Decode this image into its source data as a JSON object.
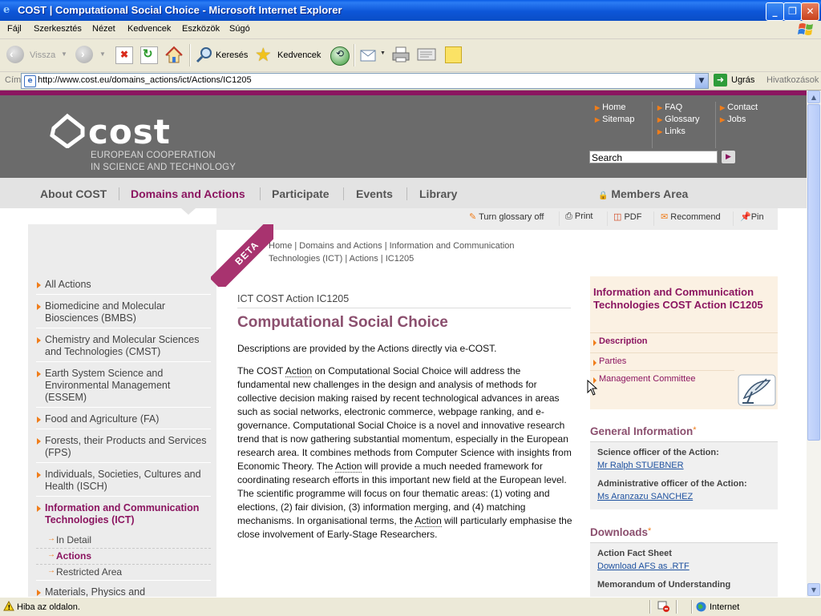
{
  "window": {
    "title": "COST | Computational Social Choice - Microsoft Internet Explorer"
  },
  "menu": [
    "Fájl",
    "Szerkesztés",
    "Nézet",
    "Kedvencek",
    "Eszközök",
    "Súgó"
  ],
  "toolbar": {
    "back": "Vissza",
    "search": "Keresés",
    "favorites": "Kedvencek"
  },
  "address": {
    "label": "Cím",
    "url": "http://www.cost.eu/domains_actions/ict/Actions/IC1205",
    "go": "Ugrás",
    "links": "Hivatkozások"
  },
  "site": {
    "tagline1": "EUROPEAN COOPERATION",
    "tagline2": "IN SCIENCE AND TECHNOLOGY",
    "toplinks": {
      "home": "Home",
      "sitemap": "Sitemap",
      "faq": "FAQ",
      "glossary": "Glossary",
      "links": "Links",
      "contact": "Contact",
      "jobs": "Jobs"
    },
    "search_value": "Search",
    "nav": [
      "About COST",
      "Domains and Actions",
      "Participate",
      "Events",
      "Library"
    ],
    "members": "Members Area",
    "tools": {
      "glossary": "Turn glossary off",
      "print": "Print",
      "pdf": "PDF",
      "recommend": "Recommend",
      "pin": "Pin"
    },
    "beta": "BETA"
  },
  "breadcrumb": "Home | Domains and Actions | Information and Communication Technologies (ICT) | Actions | IC1205",
  "leftnav": {
    "items": [
      "All Actions",
      "Biomedicine and Molecular Biosciences (BMBS)",
      "Chemistry and Molecular Sciences and Technologies (CMST)",
      "Earth System Science and Environmental Management (ESSEM)",
      "Food and Agriculture (FA)",
      "Forests, their Products and Services (FPS)",
      "Individuals, Societies, Cultures and Health (ISCH)",
      "Information and Communication Technologies (ICT)",
      "Materials, Physics and Nanosciences (MPNS)"
    ],
    "sub": [
      "In Detail",
      "Actions",
      "Restricted Area"
    ]
  },
  "content": {
    "subtitle": "ICT COST Action IC1205",
    "title": "Computational Social Choice",
    "lead": "Descriptions are provided by the Actions directly via e-COST.",
    "p1_a": "The COST ",
    "p1_action1": "Action",
    "p1_b": " on Computational Social Choice will address the fundamental new challenges in the design and analysis of methods for collective decision making raised by recent technological advances in areas such as social networks, electronic commerce, webpage ranking, and e-governance. Computational Social Choice is a novel and innovative research trend that is now gathering substantial momentum, especially in the European research area. It combines methods from Computer Science with insights from Economic Theory. The ",
    "p1_action2": "Action",
    "p1_c": " will provide a much needed framework for coordinating research efforts in this important new field at the European level. The scientific programme will focus on four thematic areas: (1) voting and elections, (2) fair division, (3) information merging, and (4) matching mechanisms. In organisational terms, the ",
    "p1_action3": "Action",
    "p1_d": " will particularly emphasise the close involvement of Early-Stage Researchers."
  },
  "rightcol": {
    "action_title": "Information and Communication Technologies COST Action IC1205",
    "links": [
      "Description",
      "Parties",
      "Management Committee"
    ],
    "general_heading": "General Information",
    "science_label": "Science officer of the Action:",
    "science_name": "Mr Ralph STUEBNER",
    "admin_label": "Administrative officer of the Action:",
    "admin_name": "Ms Aranzazu SANCHEZ",
    "downloads_heading": "Downloads",
    "afs_label": "Action Fact Sheet",
    "afs_link": "Download AFS as .RTF",
    "mou_label": "Memorandum of Understanding"
  },
  "status": {
    "text": "Hiba az oldalon.",
    "zone": "Internet"
  },
  "colors": {
    "brand": "#8b1560",
    "accent": "#f07d1a",
    "header_gray": "#6b6b6b"
  }
}
